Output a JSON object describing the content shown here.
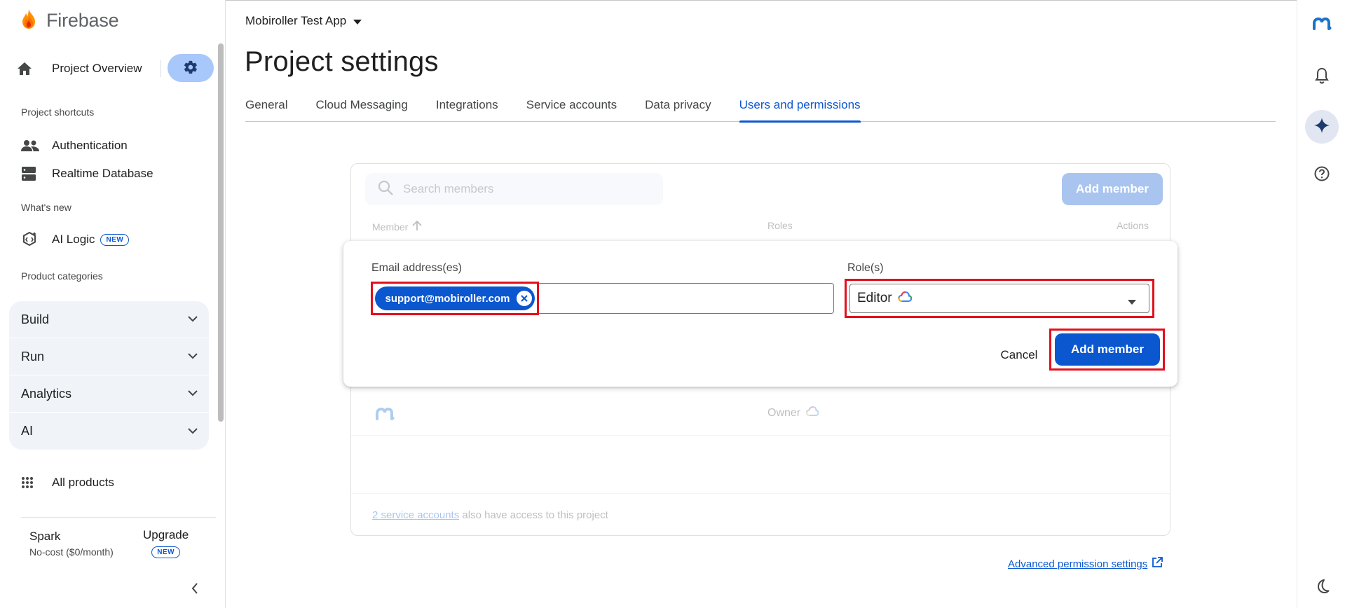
{
  "sidebar": {
    "brand": "Firebase",
    "overview_label": "Project Overview",
    "shortcuts_label": "Project shortcuts",
    "shortcuts": [
      "Authentication",
      "Realtime Database"
    ],
    "whats_new_label": "What's new",
    "ai_logic_label": "AI Logic",
    "new_badge": "NEW",
    "categories_label": "Product categories",
    "categories": [
      "Build",
      "Run",
      "Analytics",
      "AI"
    ],
    "all_products_label": "All products",
    "plan_name": "Spark",
    "plan_cost": "No-cost ($0/month)",
    "upgrade_label": "Upgrade"
  },
  "header": {
    "project_name": "Mobiroller Test App",
    "title": "Project settings",
    "tabs": [
      "General",
      "Cloud Messaging",
      "Integrations",
      "Service accounts",
      "Data privacy",
      "Users and permissions"
    ],
    "active_tab": "Users and permissions"
  },
  "members": {
    "search_placeholder": "Search members",
    "add_member_label": "Add member",
    "col_member": "Member",
    "col_roles": "Roles",
    "col_actions": "Actions",
    "owner_role": "Owner",
    "footer_link": "2 service accounts",
    "footer_text": " also have access to this project"
  },
  "dialog": {
    "email_label": "Email address(es)",
    "email_chip": "support@mobiroller.com",
    "role_label": "Role(s)",
    "role_value": "Editor",
    "cancel_label": "Cancel",
    "add_label": "Add member"
  },
  "advanced_link": "Advanced permission settings",
  "colors": {
    "accent": "#0b57d0",
    "highlight": "#e3101c",
    "gear_bg": "#a8c7fa"
  }
}
